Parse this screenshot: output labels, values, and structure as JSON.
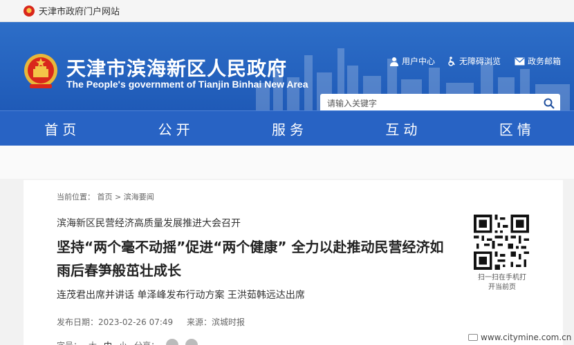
{
  "topbar": {
    "portal_label": "天津市政府门户网站"
  },
  "header": {
    "title_cn": "天津市滨海新区人民政府",
    "title_en": "The People's government of Tianjin Binhai New Area",
    "links": [
      {
        "label": "用户中心",
        "icon": "user-icon"
      },
      {
        "label": "无障碍浏览",
        "icon": "accessibility-icon"
      },
      {
        "label": "政务邮箱",
        "icon": "mail-icon"
      }
    ],
    "search_placeholder": "请输入关键字"
  },
  "nav": {
    "items": [
      "首页",
      "公开",
      "服务",
      "互动",
      "区情"
    ]
  },
  "breadcrumb": {
    "label": "当前位置：",
    "home": "首页",
    "sep": ">",
    "section": "滨海要闻"
  },
  "article": {
    "subhead": "滨海新区民营经济高质量发展推进大会召开",
    "headline": "坚持“两个毫不动摇”促进“两个健康” 全力以赴推动民营经济如雨后春笋般茁壮成长",
    "subtitle": "连茂君出席并讲话 单泽峰发布行动方案 王洪茹韩远达出席",
    "date_label": "发布日期：",
    "date": "2023-02-26 07:49",
    "source_label": "来源：",
    "source": "滨城时报",
    "font_label": "字号：",
    "font_sizes": [
      "大",
      "中",
      "小"
    ],
    "share_label": "分享："
  },
  "qr": {
    "caption_line1": "扫一扫在手机打",
    "caption_line2": "开当前页"
  },
  "watermark": "www.citymine.com.cn",
  "colors": {
    "header_blue": "#2d6ec8",
    "nav_blue": "#2863c4"
  }
}
